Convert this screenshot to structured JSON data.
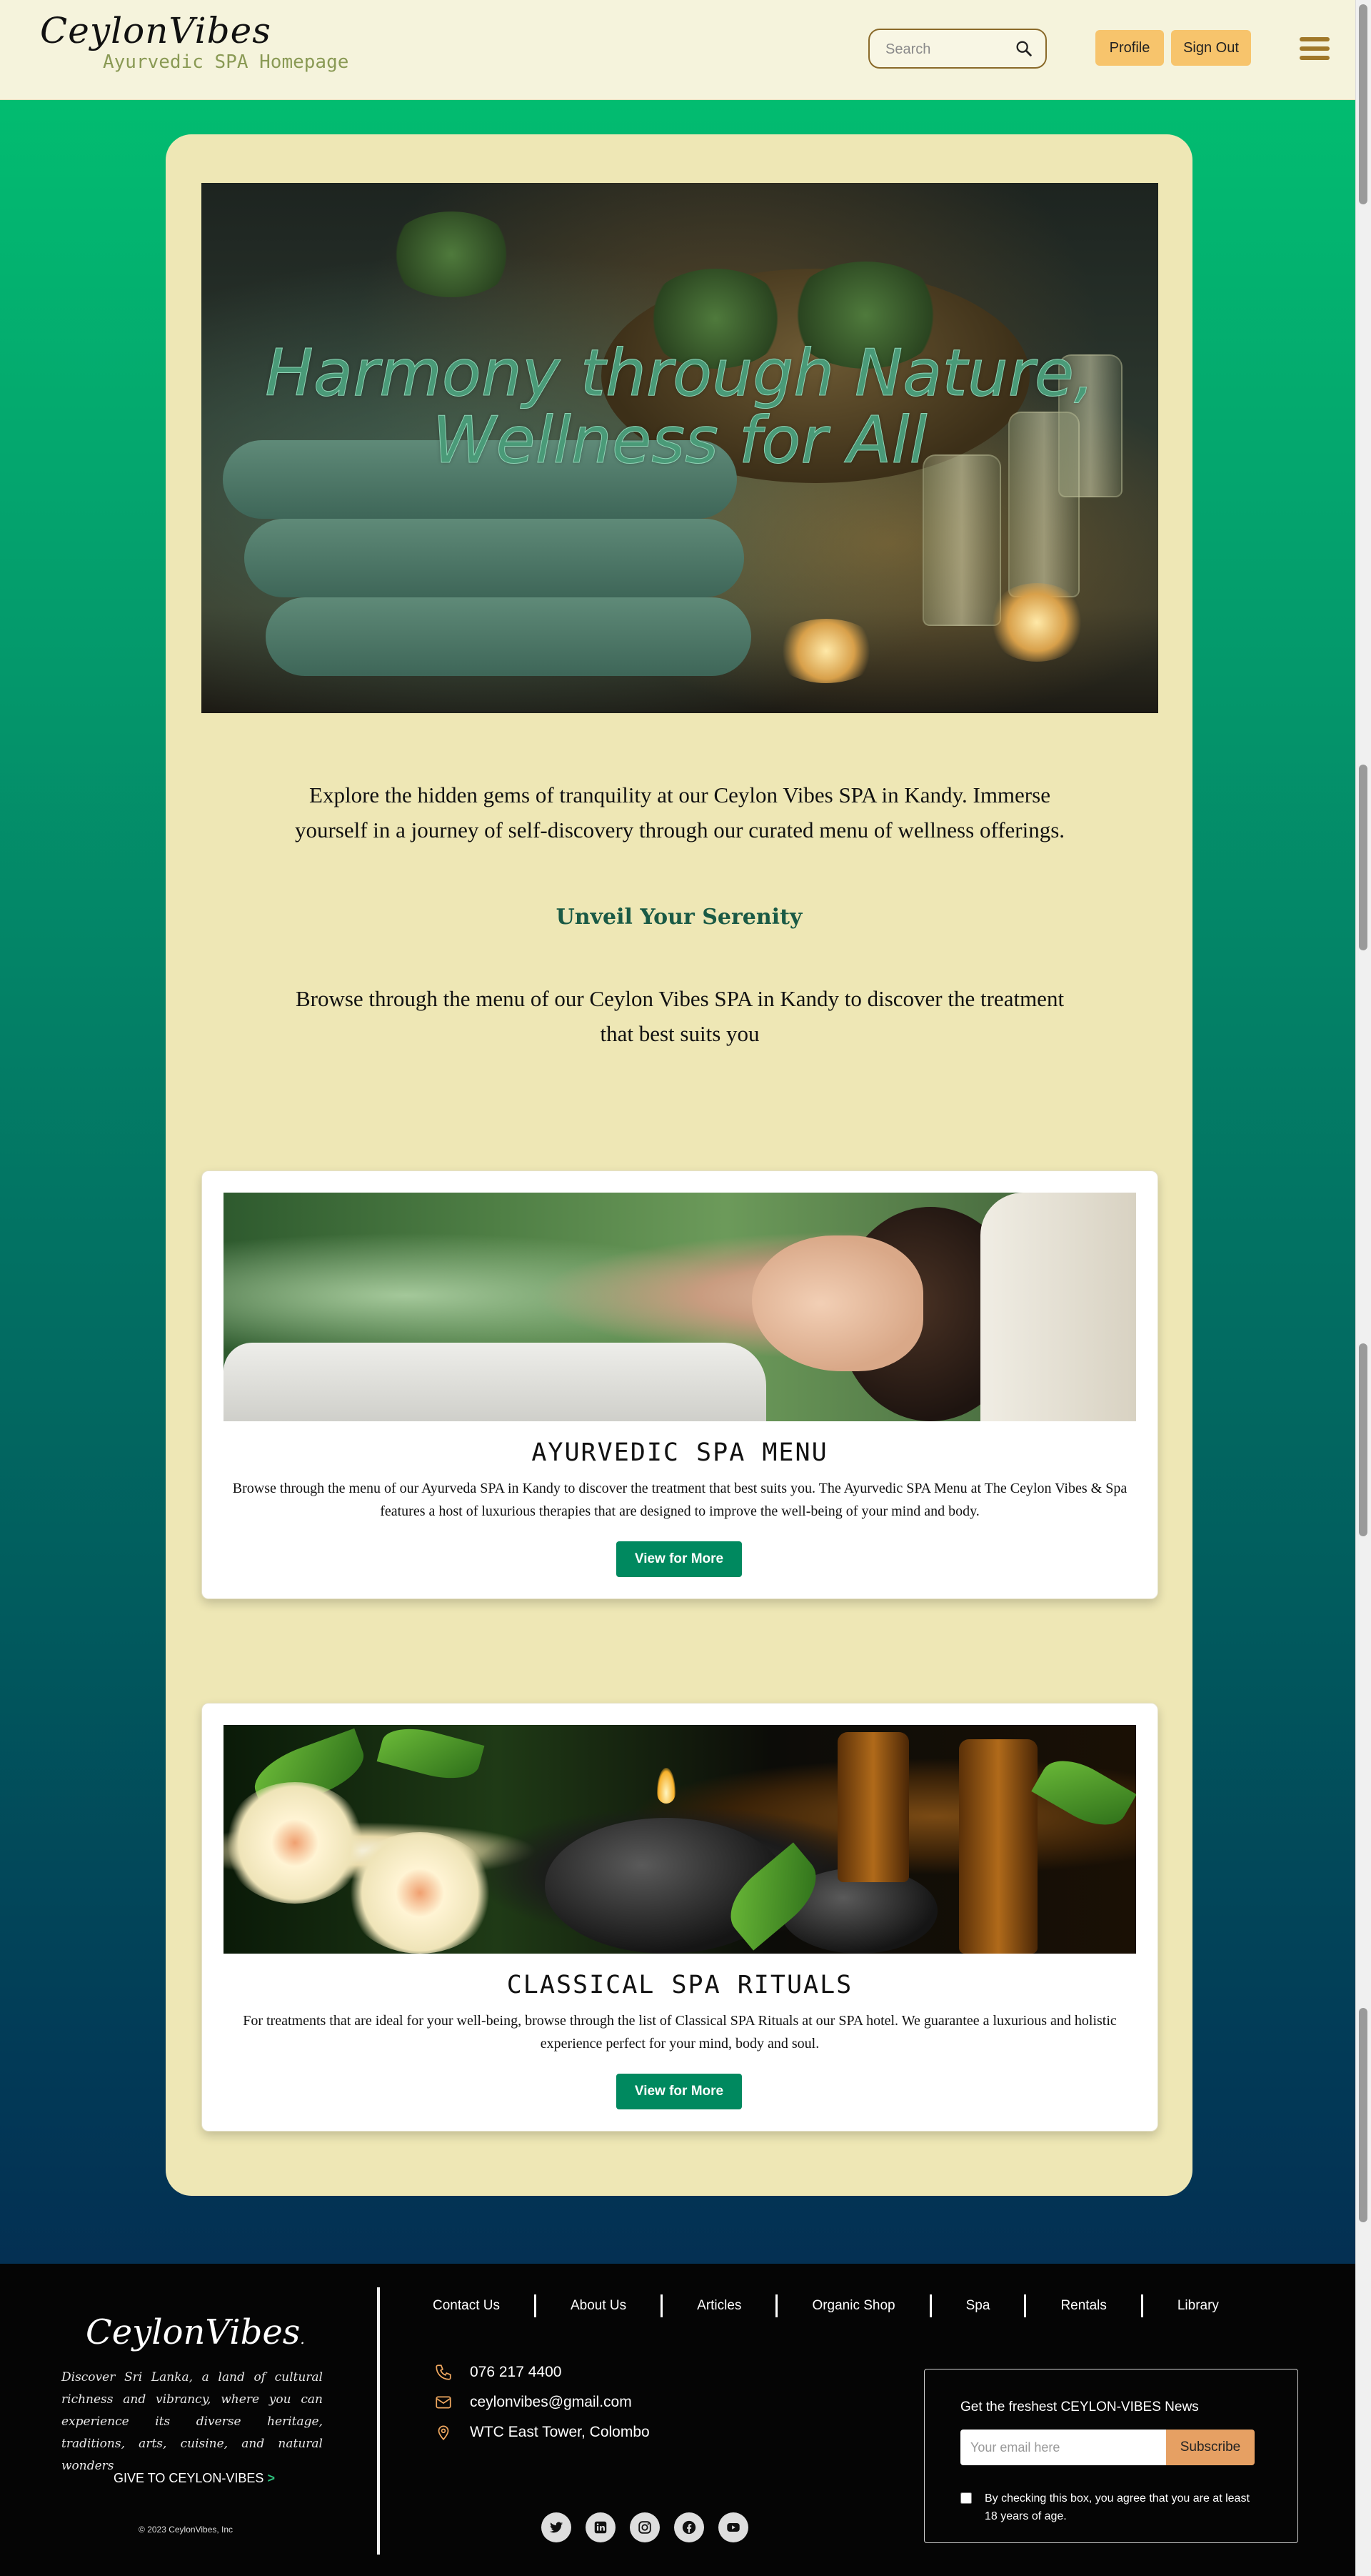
{
  "header": {
    "logo": "CeylonVibes",
    "subtitle": "Ayurvedic SPA Homepage",
    "search_placeholder": "Search",
    "profile_label": "Profile",
    "signout_label": "Sign Out"
  },
  "hero": {
    "title": "Harmony through Nature, Wellness for All"
  },
  "intro": {
    "text": "Explore the hidden gems of tranquility at our Ceylon Vibes SPA in Kandy. Immerse yourself in a journey of self-discovery through our curated menu of wellness offerings.",
    "heading": "Unveil Your Serenity",
    "browse": "Browse through the menu of our Ceylon Vibes SPA in Kandy to discover the treatment that best suits you"
  },
  "cards": [
    {
      "title": "AYURVEDIC SPA MENU",
      "description": "Browse through the menu of our Ayurveda SPA in Kandy to discover the treatment that best suits you. The Ayurvedic SPA Menu at The Ceylon Vibes & Spa features a host of luxurious therapies that are designed to improve the well-being of your mind and body.",
      "button": "View for More"
    },
    {
      "title": "CLASSICAL SPA RITUALS",
      "description": "For treatments that are ideal for your well-being, browse through the list of Classical SPA Rituals at our SPA hotel. We guarantee a luxurious and holistic experience perfect for your mind, body and soul.",
      "button": "View for More"
    }
  ],
  "footer": {
    "logo": "CeylonVibes",
    "logo_mark": ".",
    "tagline": "Discover Sri Lanka, a land of cultural richness and vibrancy, where you can experience its diverse heritage, traditions, arts, cuisine, and natural wonders",
    "give": "GIVE TO CEYLON-VIBES",
    "copyright": "2023 CeylonVibes, Inc",
    "nav": [
      "Contact Us",
      "About Us",
      "Articles",
      "Organic Shop",
      "Spa",
      "Rentals",
      "Library"
    ],
    "contact": {
      "phone": "076 217 4400",
      "email": "ceylonvibes@gmail.com",
      "address": "WTC East Tower, Colombo"
    },
    "social": [
      "twitter-icon",
      "linkedin-icon",
      "instagram-icon",
      "facebook-icon",
      "youtube-icon"
    ],
    "newsletter": {
      "title": "Get the freshest CEYLON-VIBES News",
      "placeholder": "Your email here",
      "button": "Subscribe",
      "consent": "By checking this box, you agree that you are at least 18 years of age."
    }
  },
  "colors": {
    "header_bg": "#f5f3dc",
    "panel_bg": "#eee7b5",
    "accent_button": "#f7c46c",
    "view_button": "#00895f",
    "heading_green": "#1a5a45",
    "subscribe": "#e6a063"
  }
}
